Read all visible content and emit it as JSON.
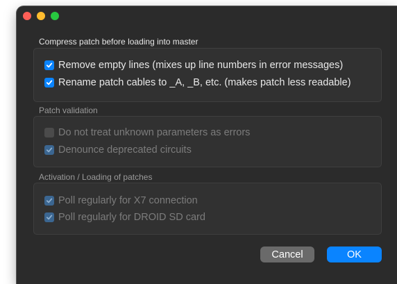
{
  "window": {
    "controls": [
      "close",
      "minimize",
      "zoom"
    ]
  },
  "sections": {
    "compress": {
      "title": "Compress patch before loading into master",
      "options": [
        {
          "label": "Remove empty lines (mixes up line numbers in error messages)",
          "checked": true,
          "enabled": true
        },
        {
          "label": "Rename patch cables to _A, _B, etc. (makes patch less readable)",
          "checked": true,
          "enabled": true
        }
      ]
    },
    "validation": {
      "title": "Patch validation",
      "options": [
        {
          "label": "Do not treat unknown parameters as errors",
          "checked": false,
          "enabled": false
        },
        {
          "label": "Denounce deprecated circuits",
          "checked": true,
          "enabled": false
        }
      ]
    },
    "activation": {
      "title": "Activation / Loading of patches",
      "options": [
        {
          "label": "Poll regularly for X7 connection",
          "checked": true,
          "enabled": false
        },
        {
          "label": "Poll regularly for DROID SD card",
          "checked": true,
          "enabled": false
        }
      ]
    }
  },
  "buttons": {
    "cancel": "Cancel",
    "ok": "OK"
  },
  "colors": {
    "accent": "#0a84ff",
    "window_bg": "#2b2b2b",
    "group_bg": "#313131"
  }
}
